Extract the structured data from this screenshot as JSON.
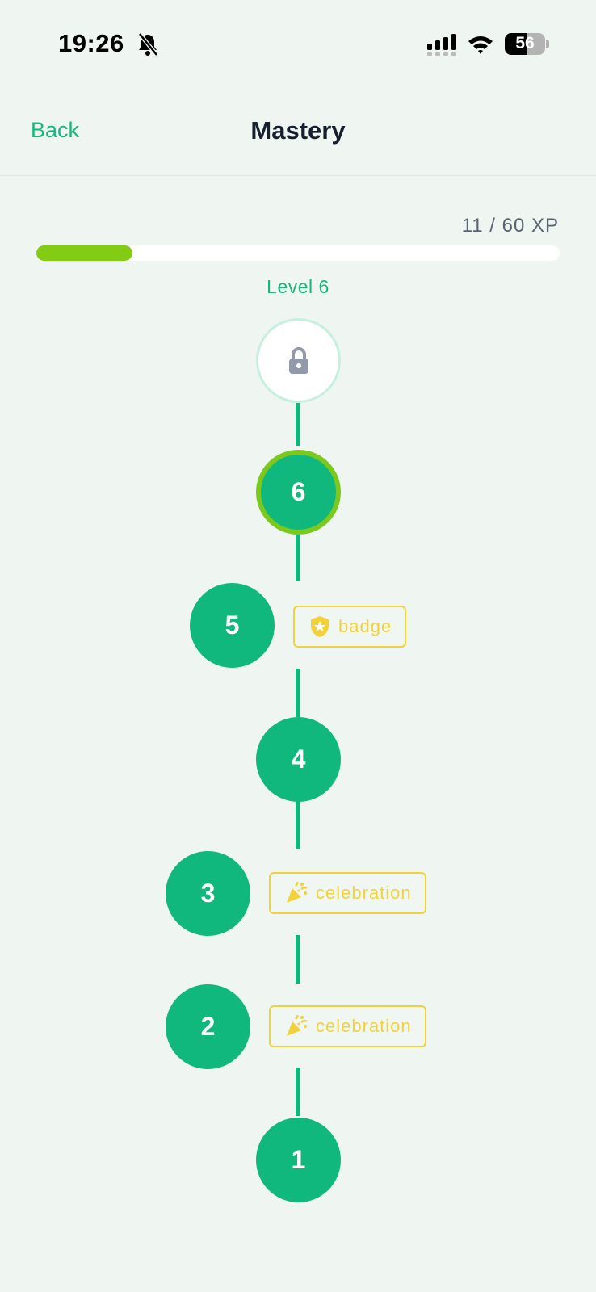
{
  "status_bar": {
    "time": "19:26",
    "battery": "56"
  },
  "nav": {
    "back_label": "Back",
    "title": "Mastery"
  },
  "progress": {
    "text": "11 / 60 XP",
    "fraction": 0.183,
    "level_label": "Level 6"
  },
  "levels": [
    {
      "label": "6",
      "state": "current"
    },
    {
      "label": "5",
      "reward": "badge",
      "reward_icon": "shield-star-icon"
    },
    {
      "label": "4"
    },
    {
      "label": "3",
      "reward": "celebration",
      "reward_icon": "party-popper-icon"
    },
    {
      "label": "2",
      "reward": "celebration",
      "reward_icon": "party-popper-icon"
    },
    {
      "label": "1"
    }
  ],
  "locked_level_icon": "lock-icon",
  "colors": {
    "accent": "#11b87e",
    "progress": "#82cc14",
    "reward": "#f1d23a"
  }
}
